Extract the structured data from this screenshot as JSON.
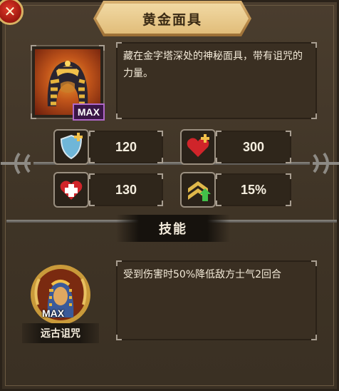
{
  "title": "黄金面具",
  "close_label": "✕",
  "item": {
    "max_label": "MAX",
    "description": "藏在金字塔深处的神秘面具，带有诅咒的力量。"
  },
  "stats": [
    {
      "icon": "shield-plus-icon",
      "value": "120"
    },
    {
      "icon": "heart-plus-icon",
      "value": "300"
    },
    {
      "icon": "heal-cross-icon",
      "value": "130"
    },
    {
      "icon": "rank-up-icon",
      "value": "15%"
    }
  ],
  "skill": {
    "header": "技能",
    "max_label": "MAX",
    "name": "远古诅咒",
    "description": "受到伤害时50%降低敌方士气2回合"
  },
  "colors": {
    "accent_gold": "#e1bd7a",
    "close_red": "#c0261a",
    "max_purple": "#b068c8"
  }
}
